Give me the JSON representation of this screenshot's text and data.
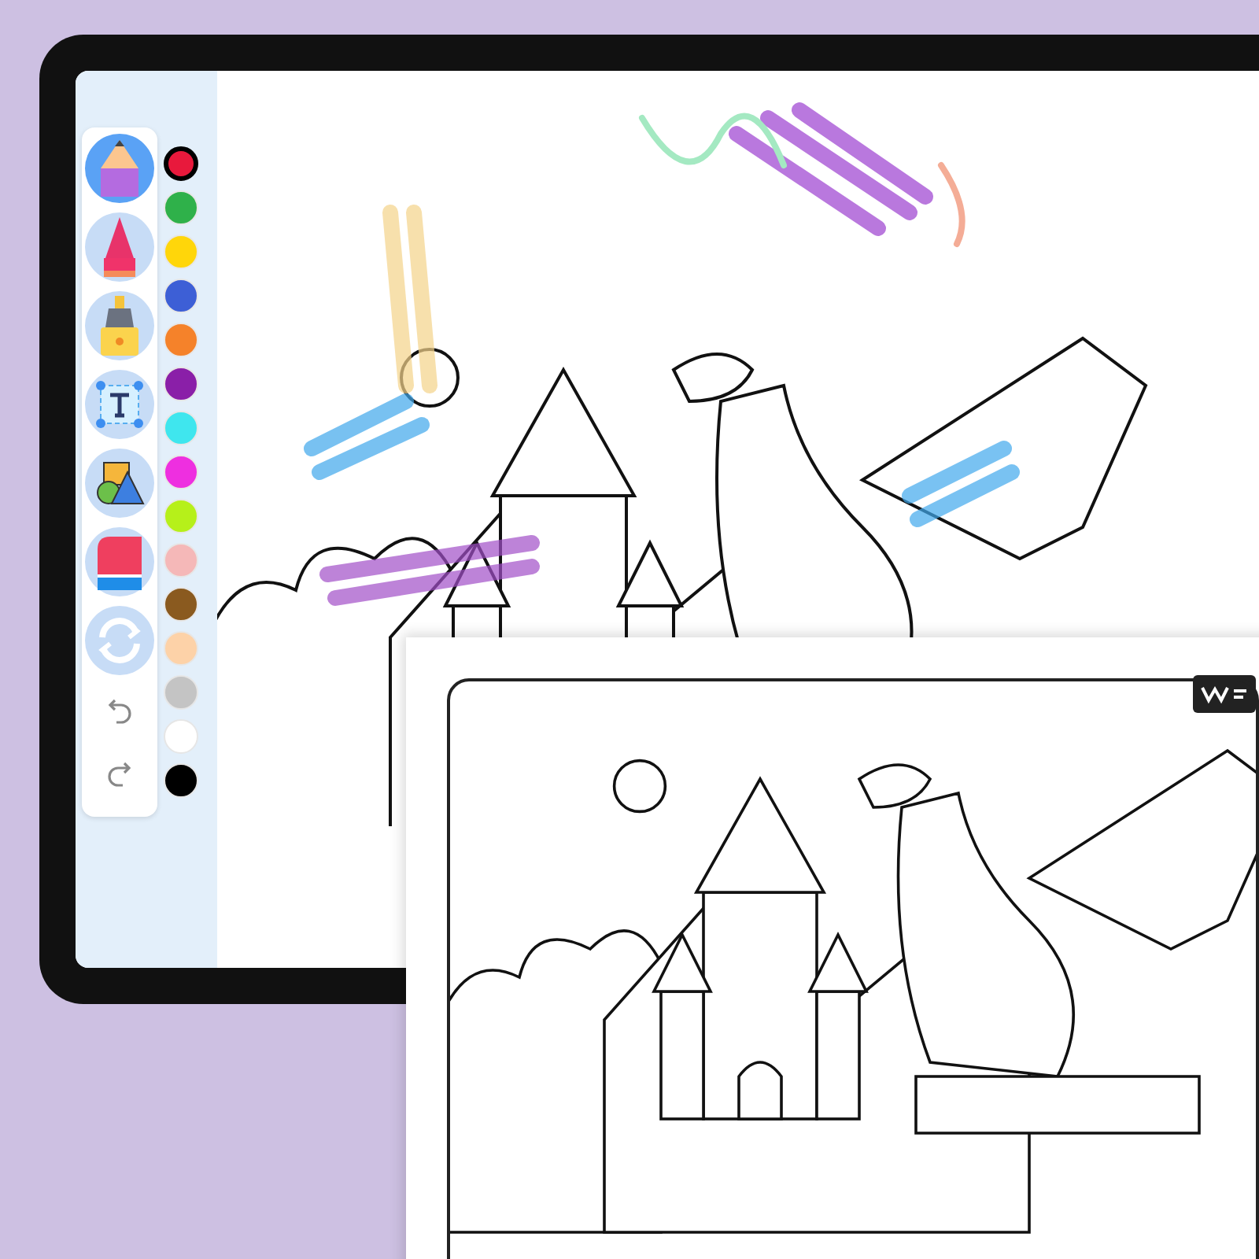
{
  "toolbar": {
    "tools": [
      {
        "kind": "pencil",
        "selected": true
      },
      {
        "kind": "crayon",
        "selected": false
      },
      {
        "kind": "marker",
        "selected": false
      },
      {
        "kind": "text",
        "selected": false
      },
      {
        "kind": "shapes",
        "selected": false
      },
      {
        "kind": "eraser",
        "selected": false
      },
      {
        "kind": "reset",
        "selected": false
      },
      {
        "kind": "undo",
        "selected": false
      },
      {
        "kind": "redo",
        "selected": false
      }
    ]
  },
  "palette": [
    {
      "color": "#e8193c",
      "selected": true
    },
    {
      "color": "#2fb14a",
      "selected": false
    },
    {
      "color": "#ffd60a",
      "selected": false
    },
    {
      "color": "#3d5fd6",
      "selected": false
    },
    {
      "color": "#f5822a",
      "selected": false
    },
    {
      "color": "#8a1fa8",
      "selected": false
    },
    {
      "color": "#3fe6ee",
      "selected": false
    },
    {
      "color": "#ee2fe0",
      "selected": false
    },
    {
      "color": "#b6f01a",
      "selected": false
    },
    {
      "color": "#f5b8b8",
      "selected": false
    },
    {
      "color": "#8a5a1f",
      "selected": false
    },
    {
      "color": "#fdd2a8",
      "selected": false
    },
    {
      "color": "#c4c4c4",
      "selected": false
    },
    {
      "color": "#ffffff",
      "selected": false
    },
    {
      "color": "#000000",
      "selected": false
    }
  ]
}
